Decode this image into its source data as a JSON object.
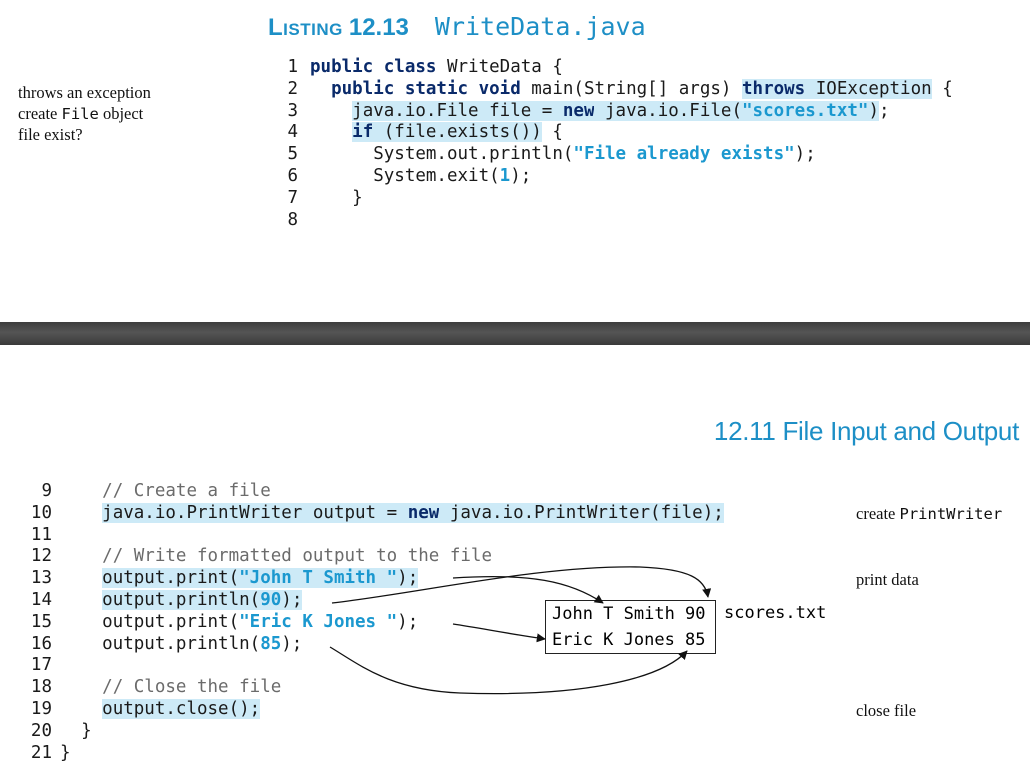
{
  "listing": {
    "label": "Listing",
    "number": "12.13",
    "filename": "WriteData.java"
  },
  "section_header": "12.11 File Input and Output",
  "margin_notes": {
    "throws_exception": "throws an exception",
    "create_file_prefix": "create ",
    "create_file_code": "File",
    "create_file_suffix": " object",
    "file_exist": "file exist?",
    "create_printwriter_prefix": "create ",
    "create_printwriter_code": "PrintWriter",
    "print_data": "print data",
    "close_file": "close file"
  },
  "code_lines": [
    {
      "n": "1",
      "parts": [
        {
          "t": "kw",
          "v": "public class"
        },
        {
          "t": "",
          "v": " WriteData {"
        }
      ]
    },
    {
      "n": "2",
      "parts": [
        {
          "t": "",
          "v": "  "
        },
        {
          "t": "kw",
          "v": "public static void"
        },
        {
          "t": "",
          "v": " main(String[] args) "
        },
        {
          "t": "kw hl",
          "v": "throws"
        },
        {
          "t": "hl",
          "v": " IOException"
        },
        {
          "t": "",
          "v": " {"
        }
      ]
    },
    {
      "n": "3",
      "parts": [
        {
          "t": "",
          "v": "    "
        },
        {
          "t": "hl",
          "v": "java.io.File file = "
        },
        {
          "t": "kw hl",
          "v": "new"
        },
        {
          "t": "hl",
          "v": " java.io.File("
        },
        {
          "t": "str hl",
          "v": "\"scores.txt\""
        },
        {
          "t": "hl",
          "v": ")"
        },
        {
          "t": "",
          "v": ";"
        }
      ]
    },
    {
      "n": "4",
      "parts": [
        {
          "t": "",
          "v": "    "
        },
        {
          "t": "kw hl",
          "v": "if"
        },
        {
          "t": "hl",
          "v": " (file.exists())"
        },
        {
          "t": "",
          "v": " {"
        }
      ]
    },
    {
      "n": "5",
      "parts": [
        {
          "t": "",
          "v": "      System.out.println("
        },
        {
          "t": "str",
          "v": "\"File already exists\""
        },
        {
          "t": "",
          "v": ");"
        }
      ]
    },
    {
      "n": "6",
      "parts": [
        {
          "t": "",
          "v": "      System.exit("
        },
        {
          "t": "str",
          "v": "1"
        },
        {
          "t": "",
          "v": ");"
        }
      ]
    },
    {
      "n": "7",
      "parts": [
        {
          "t": "",
          "v": "    }"
        }
      ]
    },
    {
      "n": "8",
      "parts": [
        {
          "t": "",
          "v": ""
        }
      ]
    }
  ],
  "code_lines_2": [
    {
      "n": "9",
      "parts": [
        {
          "t": "",
          "v": "    "
        },
        {
          "t": "cm",
          "v": "// Create a file"
        }
      ]
    },
    {
      "n": "10",
      "parts": [
        {
          "t": "",
          "v": "    "
        },
        {
          "t": "hl",
          "v": "java.io.PrintWriter output = "
        },
        {
          "t": "kw hl",
          "v": "new"
        },
        {
          "t": "hl",
          "v": " java.io.PrintWriter(file);"
        }
      ]
    },
    {
      "n": "11",
      "parts": [
        {
          "t": "",
          "v": ""
        }
      ]
    },
    {
      "n": "12",
      "parts": [
        {
          "t": "",
          "v": "    "
        },
        {
          "t": "cm",
          "v": "// Write formatted output to the file"
        }
      ]
    },
    {
      "n": "13",
      "parts": [
        {
          "t": "",
          "v": "    "
        },
        {
          "t": "hl",
          "v": "output.print("
        },
        {
          "t": "str hl",
          "v": "\"John T Smith \""
        },
        {
          "t": "hl",
          "v": ");"
        }
      ]
    },
    {
      "n": "14",
      "parts": [
        {
          "t": "",
          "v": "    "
        },
        {
          "t": "hl",
          "v": "output.println("
        },
        {
          "t": "str hl",
          "v": "90"
        },
        {
          "t": "hl",
          "v": ");"
        }
      ]
    },
    {
      "n": "15",
      "parts": [
        {
          "t": "",
          "v": "    output.print("
        },
        {
          "t": "str",
          "v": "\"Eric K Jones \""
        },
        {
          "t": "",
          "v": ");"
        }
      ]
    },
    {
      "n": "16",
      "parts": [
        {
          "t": "",
          "v": "    output.println("
        },
        {
          "t": "str",
          "v": "85"
        },
        {
          "t": "",
          "v": ");"
        }
      ]
    },
    {
      "n": "17",
      "parts": [
        {
          "t": "",
          "v": ""
        }
      ]
    },
    {
      "n": "18",
      "parts": [
        {
          "t": "",
          "v": "    "
        },
        {
          "t": "cm",
          "v": "// Close the file"
        }
      ]
    },
    {
      "n": "19",
      "parts": [
        {
          "t": "",
          "v": "    "
        },
        {
          "t": "hl",
          "v": "output.close();"
        }
      ]
    },
    {
      "n": "20",
      "parts": [
        {
          "t": "",
          "v": "  }"
        }
      ]
    },
    {
      "n": "21",
      "parts": [
        {
          "t": "",
          "v": "}"
        }
      ]
    }
  ],
  "output_file": {
    "line1": "John T Smith 90",
    "line2": "Eric K Jones 85",
    "label": "scores.txt"
  }
}
